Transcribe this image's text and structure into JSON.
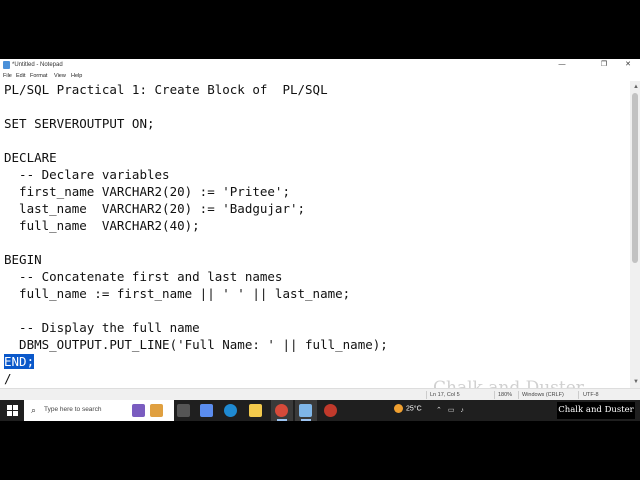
{
  "window": {
    "title": "*Untitled - Notepad",
    "controls": {
      "minimize": "—",
      "maximize": "❐",
      "close": "✕"
    }
  },
  "menu": [
    "File",
    "Edit",
    "Format",
    "View",
    "Help"
  ],
  "editor": {
    "lines": [
      "PL/SQL Practical 1: Create Block of  PL/SQL",
      "",
      "SET SERVEROUTPUT ON;",
      "",
      "DECLARE",
      "  -- Declare variables",
      "  first_name VARCHAR2(20) := 'Pritee';",
      "  last_name  VARCHAR2(20) := 'Badgujar';",
      "  full_name  VARCHAR2(40);",
      "",
      "BEGIN",
      "  -- Concatenate first and last names",
      "  full_name := first_name || ' ' || last_name;",
      "",
      "  -- Display the full name",
      "  DBMS_OUTPUT.PUT_LINE('Full Name: ' || full_name);",
      "END;",
      "/"
    ],
    "selected_text": "END;"
  },
  "status": {
    "position": "Ln 17, Col 5",
    "zoom": "180%",
    "line_ending": "Windows (CRLF)",
    "encoding": "UTF-8"
  },
  "watermark": "Chalk and Duster",
  "taskbar": {
    "search_placeholder": "Type here to search",
    "weather": "25°C",
    "brand": "Chalk and Duster",
    "tray_icons": [
      "chevron-up-icon",
      "network-icon",
      "volume-icon"
    ]
  },
  "colors": {
    "selection": "#0a58ca",
    "taskbar": "#1f1f1f",
    "accent": "#9cc3f0"
  }
}
